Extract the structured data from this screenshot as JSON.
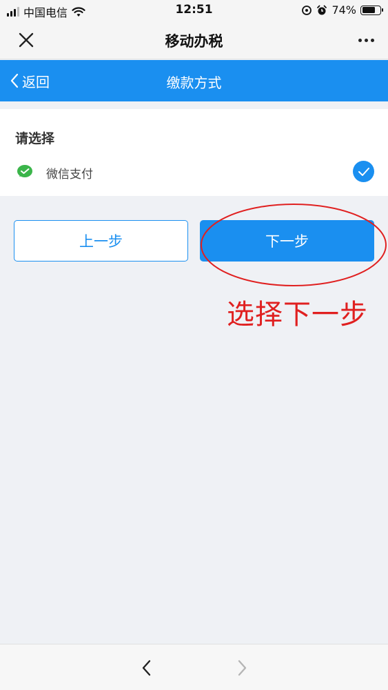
{
  "status_bar": {
    "carrier": "中国电信",
    "time": "12:51",
    "battery_percent": "74%",
    "battery_level": 0.74,
    "icons": [
      "signal-icon",
      "wifi-icon",
      "location-icon",
      "alarm-icon",
      "battery-icon"
    ]
  },
  "app_bar": {
    "title": "移动办税",
    "icons": [
      "close-icon",
      "more-icon"
    ]
  },
  "nav_bar": {
    "back_label": "返回",
    "title": "缴款方式"
  },
  "payment": {
    "heading": "请选择",
    "options": [
      {
        "label": "微信支付",
        "icon": "wechat-pay-icon",
        "selected": true
      }
    ]
  },
  "buttons": {
    "prev_label": "上一步",
    "next_label": "下一步"
  },
  "annotation": {
    "text": "选择下一步",
    "color": "#e02020"
  },
  "colors": {
    "primary": "#1a8ff0",
    "background": "#eff1f5",
    "wechat_green": "#3bb54a"
  }
}
